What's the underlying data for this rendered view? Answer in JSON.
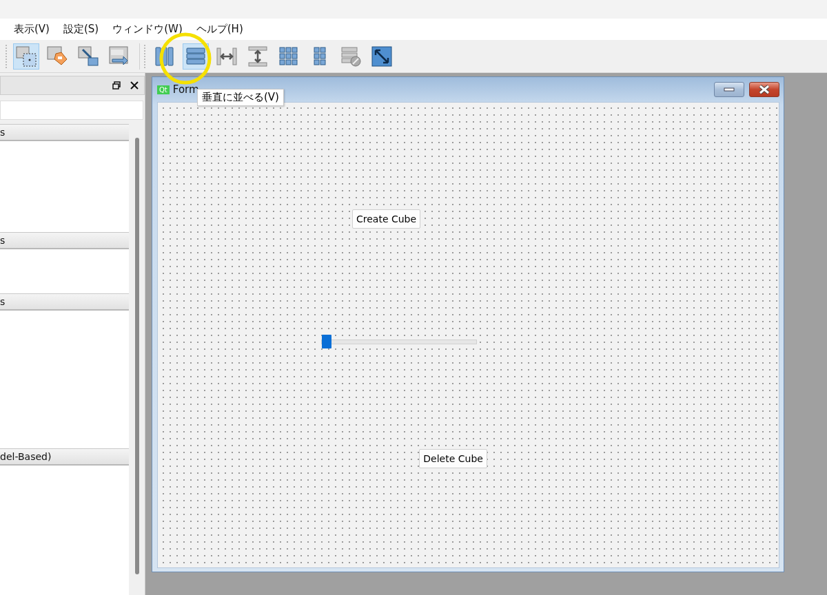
{
  "menu": [
    {
      "label": "表示(V)"
    },
    {
      "label": "設定(S)"
    },
    {
      "label": "ウィンドウ(W)"
    },
    {
      "label": "ヘルプ(H)"
    }
  ],
  "toolbar": {
    "groups": [
      [
        {
          "kind": "edit-widgets",
          "selected": true
        },
        {
          "kind": "edit-buddies",
          "selected": false
        },
        {
          "kind": "edit-signals",
          "selected": false
        },
        {
          "kind": "edit-tab-order",
          "selected": false
        }
      ],
      [
        {
          "kind": "layout-horizontal",
          "selected": false
        },
        {
          "kind": "layout-vertical",
          "selected": true
        },
        {
          "kind": "splitter-horizontal",
          "selected": false
        },
        {
          "kind": "splitter-vertical",
          "selected": false
        },
        {
          "kind": "layout-grid",
          "selected": false
        },
        {
          "kind": "layout-form",
          "selected": false
        },
        {
          "kind": "break-layout",
          "selected": false
        },
        {
          "kind": "adjust-size",
          "selected": false
        }
      ]
    ]
  },
  "tooltip": "垂直に並べる(V)",
  "widget_box": {
    "sections": [
      {
        "title": "s"
      },
      {
        "title": "s"
      },
      {
        "title": "s"
      },
      {
        "title": "del-Based)"
      }
    ]
  },
  "form": {
    "logo": "Qt",
    "title": "Form",
    "widgets": [
      {
        "kind": "button",
        "label": "Create Cube"
      },
      {
        "kind": "slider",
        "level": 0
      },
      {
        "kind": "button",
        "label": "Delete Cube"
      }
    ]
  }
}
